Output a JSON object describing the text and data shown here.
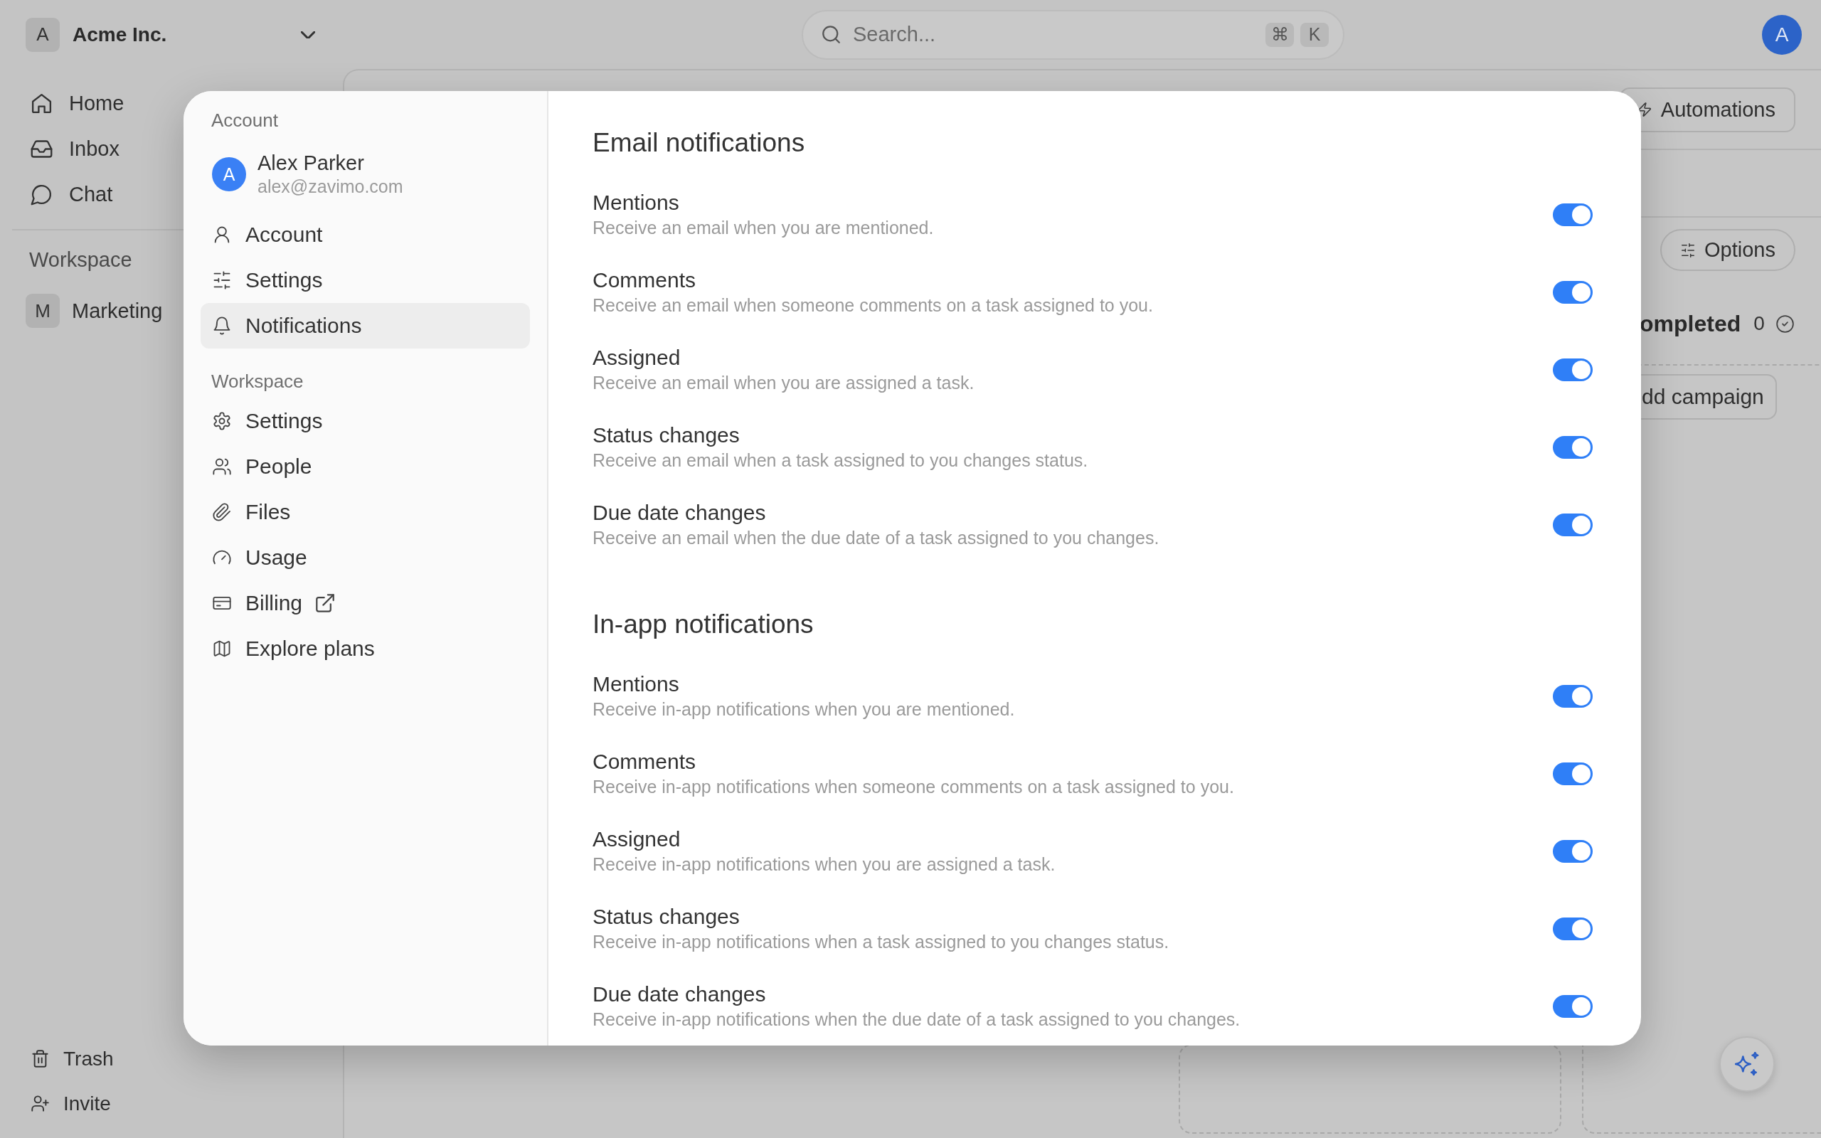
{
  "workspace_switcher": {
    "initial": "A",
    "name": "Acme Inc."
  },
  "search": {
    "placeholder": "Search...",
    "shortcut": [
      "⌘",
      "K"
    ]
  },
  "account_avatar": {
    "initial": "A"
  },
  "sidebar": {
    "items": [
      {
        "label": "Home",
        "selected": false
      },
      {
        "label": "Inbox",
        "selected": false
      },
      {
        "label": "Chat",
        "selected": false
      }
    ],
    "section_label": "Workspace",
    "workspaces": [
      {
        "initial": "M",
        "label": "Marketing",
        "selected": false
      }
    ],
    "footer_items": [
      {
        "label": "Trash"
      },
      {
        "label": "Invite"
      }
    ]
  },
  "board": {
    "automations_button": {
      "label": "Automations"
    },
    "options_button": {
      "label": "Options"
    },
    "column": {
      "title": "ompleted",
      "count": "0",
      "add_button": "dd campaign"
    }
  },
  "settings_dialog": {
    "nav": {
      "sections": [
        {
          "label": "Account",
          "user": {
            "initial": "A",
            "name": "Alex Parker",
            "email": "alex@zavimo.com"
          },
          "items": [
            {
              "label": "Account",
              "selected": false,
              "external": false
            },
            {
              "label": "Settings",
              "selected": false,
              "external": false
            },
            {
              "label": "Notifications",
              "selected": true,
              "external": false
            }
          ]
        },
        {
          "label": "Workspace",
          "items": [
            {
              "label": "Settings",
              "selected": false,
              "external": false
            },
            {
              "label": "People",
              "selected": false,
              "external": false
            },
            {
              "label": "Files",
              "selected": false,
              "external": false
            },
            {
              "label": "Usage",
              "selected": false,
              "external": false
            },
            {
              "label": "Billing",
              "selected": false,
              "external": true
            },
            {
              "label": "Explore plans",
              "selected": false,
              "external": false
            }
          ]
        }
      ]
    },
    "content": {
      "sections": [
        {
          "title": "Email notifications",
          "items": [
            {
              "title": "Mentions",
              "description": "Receive an email when you are mentioned.",
              "on": true
            },
            {
              "title": "Comments",
              "description": "Receive an email when someone comments on a task assigned to you.",
              "on": true
            },
            {
              "title": "Assigned",
              "description": "Receive an email when you are assigned a task.",
              "on": true
            },
            {
              "title": "Status changes",
              "description": "Receive an email when a task assigned to you changes status.",
              "on": true
            },
            {
              "title": "Due date changes",
              "description": "Receive an email when the due date of a task assigned to you changes.",
              "on": true
            }
          ]
        },
        {
          "title": "In-app notifications",
          "items": [
            {
              "title": "Mentions",
              "description": "Receive in-app notifications when you are mentioned.",
              "on": true
            },
            {
              "title": "Comments",
              "description": "Receive in-app notifications when someone comments on a task assigned to you.",
              "on": true
            },
            {
              "title": "Assigned",
              "description": "Receive in-app notifications when you are assigned a task.",
              "on": true
            },
            {
              "title": "Status changes",
              "description": "Receive in-app notifications when a task assigned to you changes status.",
              "on": true
            },
            {
              "title": "Due date changes",
              "description": "Receive in-app notifications when the due date of a task assigned to you changes.",
              "on": true
            }
          ]
        }
      ]
    }
  }
}
